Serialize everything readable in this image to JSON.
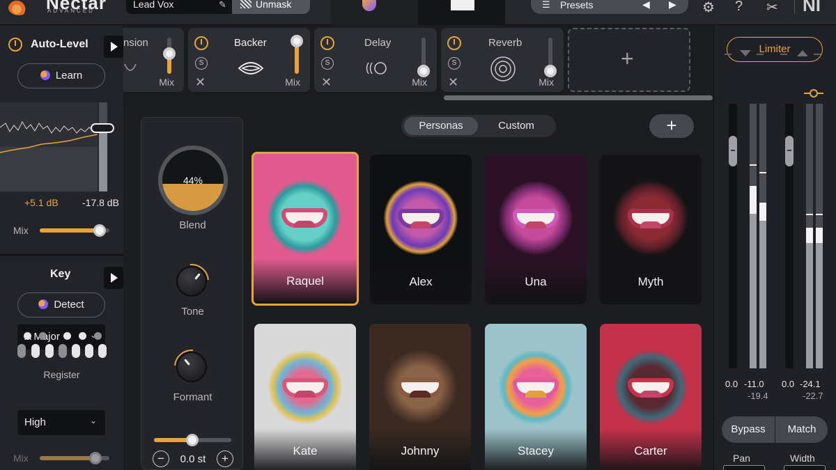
{
  "header": {
    "brand_name": "Nectar",
    "brand_sub": "ADVANCED",
    "track_name": "Lead Vox",
    "unmask_label": "Unmask",
    "presets_label": "Presets",
    "ni_logo": "NI"
  },
  "autolevel": {
    "title": "Auto-Level",
    "learn_label": "Learn",
    "gain_db": "+5.1 dB",
    "level_db": "-17.8 dB",
    "mix_label": "Mix",
    "mix_value": 0.86
  },
  "key": {
    "title": "Key",
    "detect_label": "Detect",
    "key_value": "A Major",
    "register_label": "Register",
    "register_value": "High",
    "mix_label": "Mix",
    "mix_value": 0.8
  },
  "modules": [
    {
      "name": "Dimension",
      "name_visible": "nsion",
      "mix_label": "Mix",
      "mix_value": 0.55
    },
    {
      "name": "Backer",
      "mix_label": "Mix",
      "mix_value": 0.9
    },
    {
      "name": "Delay",
      "mix_label": "Mix",
      "mix_value": 0.08
    },
    {
      "name": "Reverb",
      "mix_label": "Mix",
      "mix_value": 0.08
    }
  ],
  "controls": {
    "blend_value": "44%",
    "blend_label": "Blend",
    "tone_label": "Tone",
    "formant_label": "Formant",
    "pitch_value": "0.0 st",
    "pitch_minus": "−",
    "pitch_plus": "+"
  },
  "personas": {
    "tabs": [
      "Personas",
      "Custom"
    ],
    "selected_tab": "Personas",
    "add_label": "+",
    "cards": [
      {
        "name": "Raquel",
        "selected": true,
        "bg": "#e05a8e"
      },
      {
        "name": "Alex",
        "selected": false,
        "bg": "#0f1013"
      },
      {
        "name": "Una",
        "selected": false,
        "bg": "#2a1224"
      },
      {
        "name": "Myth",
        "selected": false,
        "bg": "#141416"
      },
      {
        "name": "Kate",
        "selected": false,
        "bg": "#d9d9da"
      },
      {
        "name": "Johnny",
        "selected": false,
        "bg": "#3a2a22"
      },
      {
        "name": "Stacey",
        "selected": false,
        "bg": "#9cc3c9"
      },
      {
        "name": "Carter",
        "selected": false,
        "bg": "#c4314b"
      }
    ]
  },
  "meters": {
    "limiter_label": "Limiter",
    "in_gain": "0.0",
    "in_peak": "-11.0",
    "in_rms": "-19.4",
    "out_gain": "0.0",
    "out_peak": "-24.1",
    "out_rms": "-22.7",
    "bypass_label": "Bypass",
    "match_label": "Match",
    "pan_label": "Pan",
    "width_label": "Width"
  },
  "colors": {
    "accent": "#e7a43a",
    "panel": "#232429",
    "background": "#1c1d21"
  }
}
